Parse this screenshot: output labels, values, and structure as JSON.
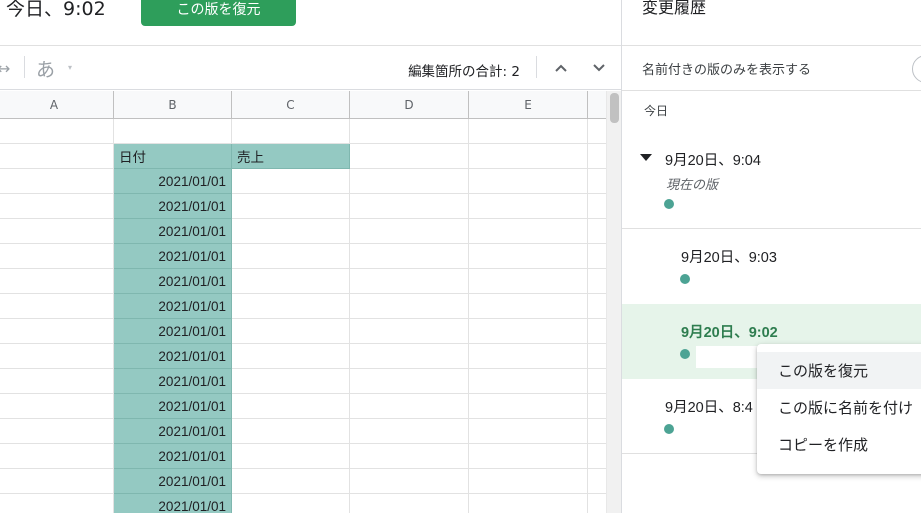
{
  "header": {
    "title": "今日、9:02",
    "restore_button": "この版を復元"
  },
  "toolbar": {
    "left_fragment": "↔",
    "ime_glyph": "あ",
    "ime_dropdown": "▾",
    "edit_count_label": "編集箇所の合計: 2",
    "prev_icon": "chevron-up",
    "next_icon": "chevron-down"
  },
  "sheet": {
    "columns": [
      "A",
      "B",
      "C",
      "D",
      "E"
    ],
    "header_row": {
      "b": "日付",
      "c": "売上"
    },
    "dates": [
      "2021/01/01",
      "2021/01/01",
      "2021/01/01",
      "2021/01/01",
      "2021/01/01",
      "2021/01/01",
      "2021/01/01",
      "2021/01/01",
      "2021/01/01",
      "2021/01/01",
      "2021/01/01",
      "2021/01/01",
      "2021/01/01",
      "2021/01/01"
    ],
    "highlight_color": "#94c9c2"
  },
  "panel": {
    "title": "変更履歴",
    "named_only_label": "名前付きの版のみを表示する",
    "today_label": "今日",
    "versions": [
      {
        "time": "9月20日、9:04",
        "subtitle": "現在の版"
      },
      {
        "time": "9月20日、9:03"
      },
      {
        "time": "9月20日、9:02"
      },
      {
        "time": "9月20日、8:4"
      }
    ],
    "dot_color": "#4ca394",
    "selected_bg": "#e6f4ea"
  },
  "context_menu": {
    "items": [
      "この版を復元",
      "この版に名前を付け",
      "コピーを作成"
    ]
  }
}
